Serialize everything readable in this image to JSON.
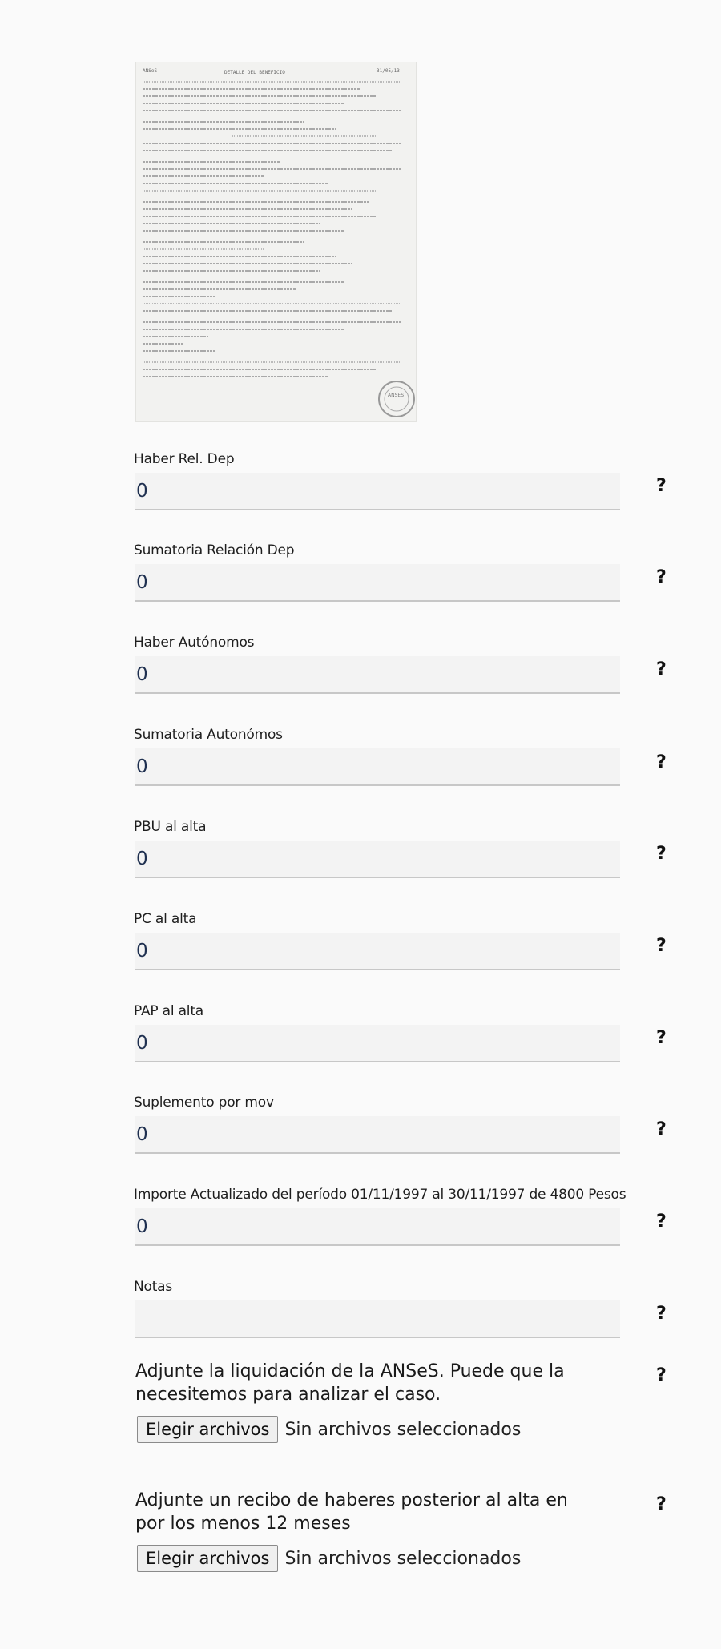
{
  "document_image": {
    "header_left": "ANSeS",
    "header_center": "DETALLE DEL BENEFICIO",
    "header_right": "31/05/13",
    "seal_text": "ANSES"
  },
  "fields": [
    {
      "label": "Haber Rel. Dep",
      "value": "0",
      "help": "?"
    },
    {
      "label": "Sumatoria Relación Dep",
      "value": "0",
      "help": "?"
    },
    {
      "label": "Haber Autónomos",
      "value": "0",
      "help": "?"
    },
    {
      "label": "Sumatoria Autonómos",
      "value": "0",
      "help": "?"
    },
    {
      "label": "PBU al alta",
      "value": "0",
      "help": "?"
    },
    {
      "label": "PC al alta",
      "value": "0",
      "help": "?"
    },
    {
      "label": "PAP al alta",
      "value": "0",
      "help": "?"
    },
    {
      "label": "Suplemento por mov",
      "value": "0",
      "help": "?"
    },
    {
      "label": "Importe Actualizado del período 01/11/1997 al 30/11/1997 de 4800 Pesos",
      "value": "0",
      "help": "?"
    },
    {
      "label": "Notas",
      "value": "",
      "help": "?"
    }
  ],
  "uploads": [
    {
      "label": "Adjunte la liquidación de la ANSeS. Puede que la necesitemos para analizar el caso.",
      "button": "Elegir archivos",
      "status": "Sin archivos seleccionados",
      "help": "?"
    },
    {
      "label": "Adjunte un recibo de haberes posterior al alta en por los menos 12 meses",
      "button": "Elegir archivos",
      "status": "Sin archivos seleccionados",
      "help": "?"
    }
  ]
}
